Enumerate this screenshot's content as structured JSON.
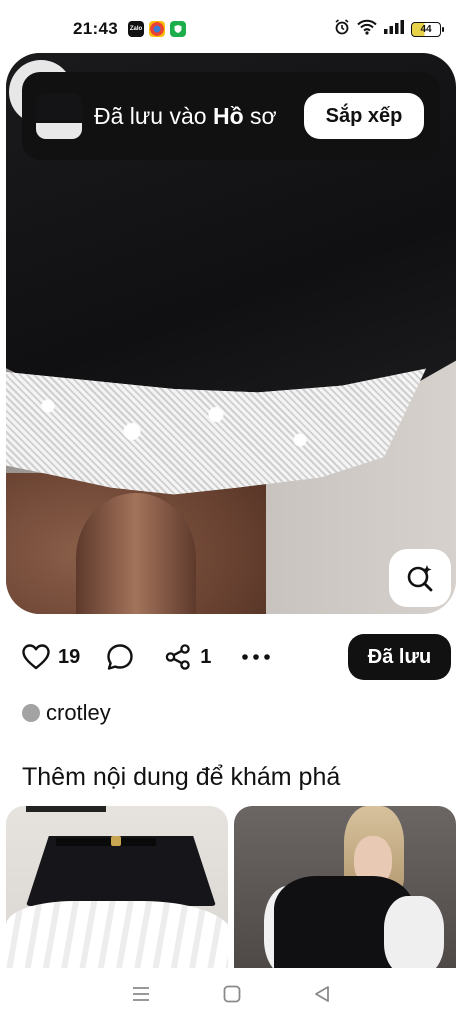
{
  "status_bar": {
    "time": "21:43",
    "battery": "44",
    "apps": [
      "zalo-icon",
      "browser-icon",
      "shield-icon"
    ]
  },
  "toast": {
    "text_prefix": "Đã lưu vào ",
    "text_bold": "Hồ",
    "text_suffix": "sơ",
    "button_label": "Sắp xếp"
  },
  "pin": {
    "likes": "19",
    "shares": "1",
    "save_label": "Đã lưu",
    "author": "crotley"
  },
  "section": {
    "title": "Thêm nội dung để khám phá"
  },
  "colors": {
    "primary_dark": "#111111",
    "background": "#ffffff",
    "battery_fill": "#e8d24a"
  }
}
